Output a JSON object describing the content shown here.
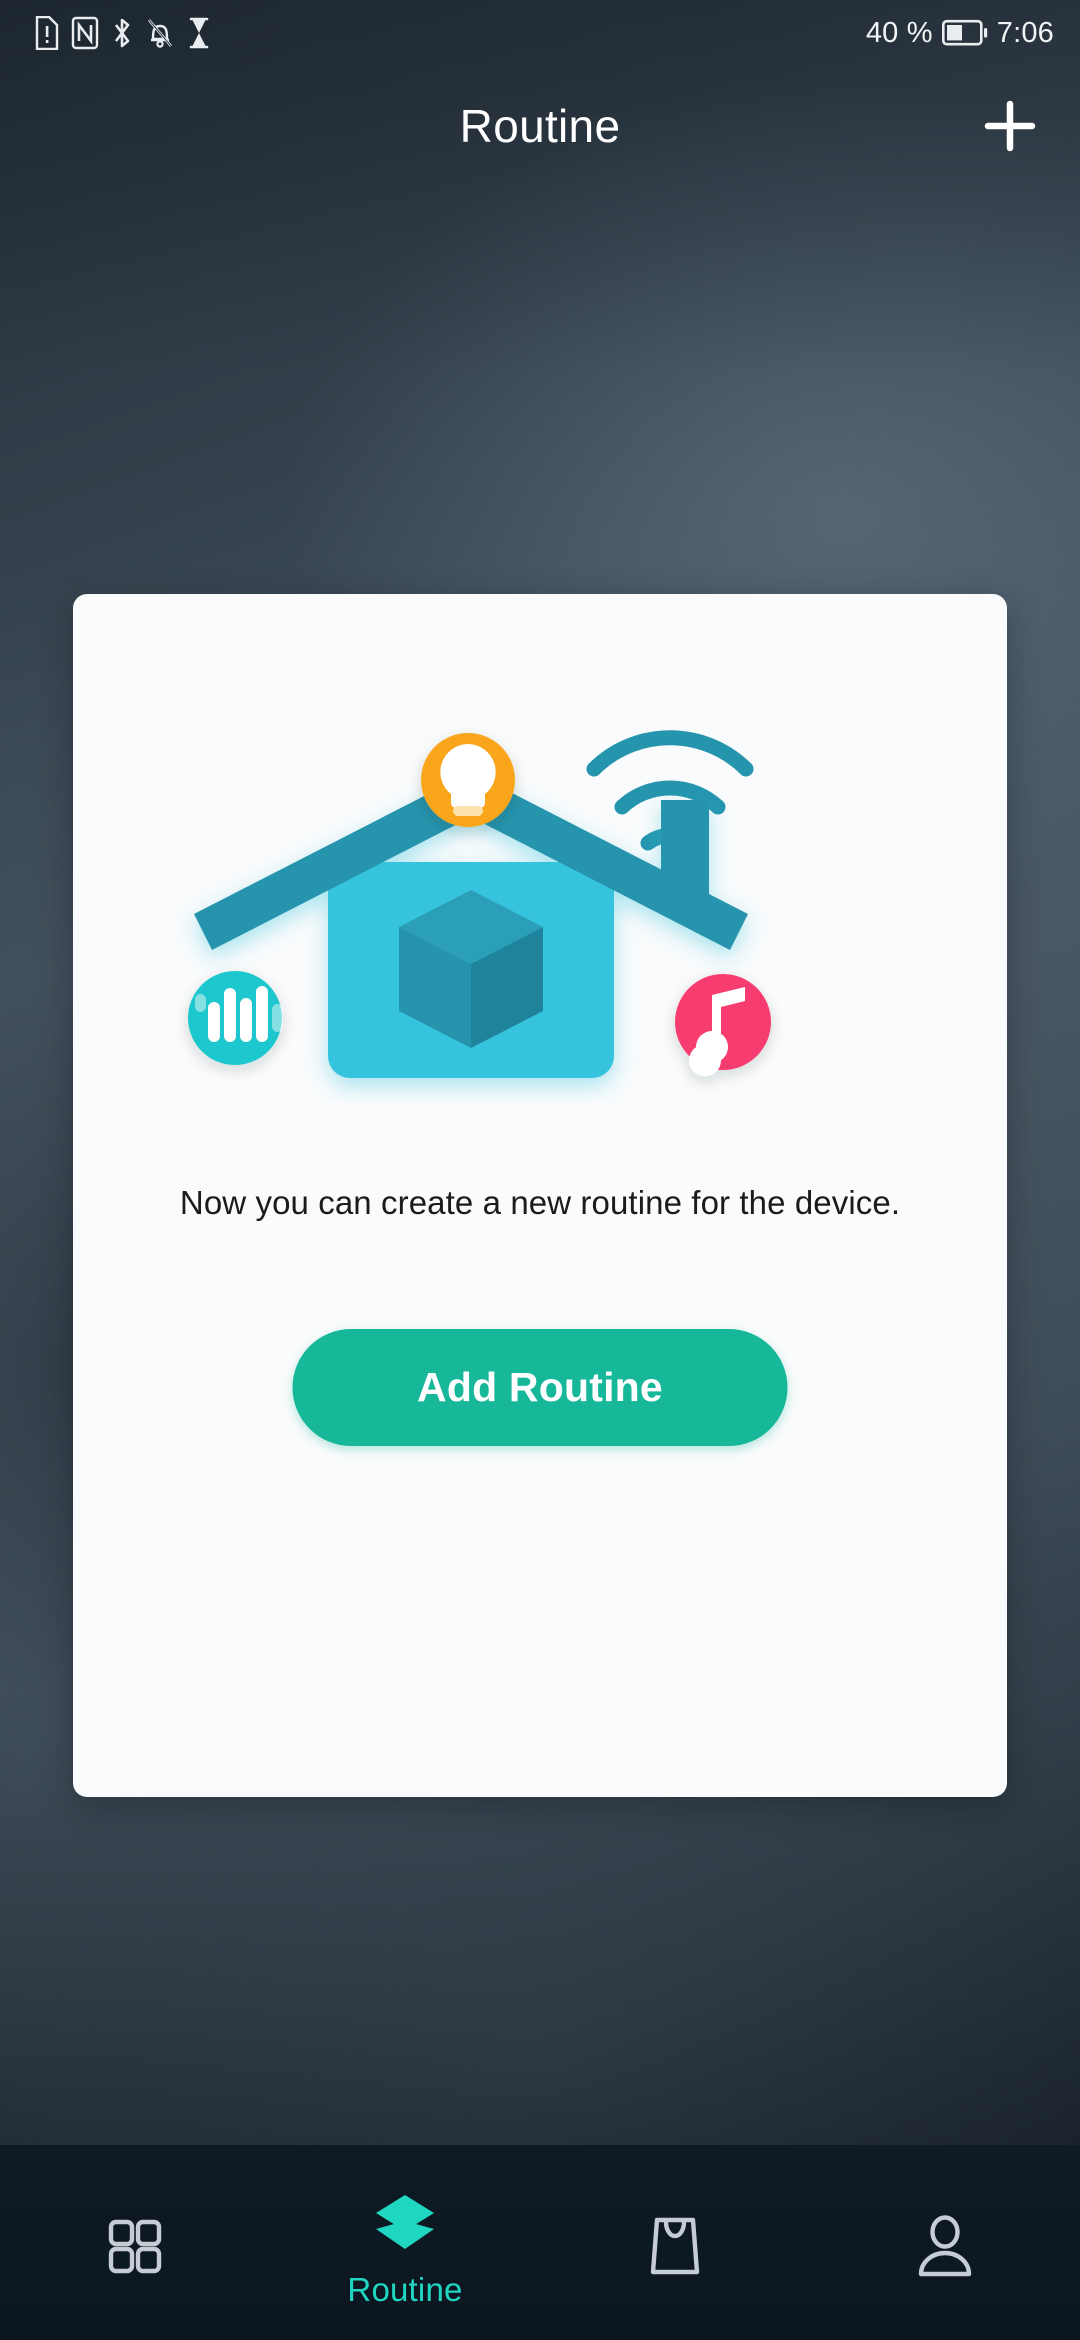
{
  "status_bar": {
    "icons": [
      "sim-alert-icon",
      "nfc-icon",
      "bluetooth-icon",
      "notifications-silenced-icon",
      "hourglass-icon"
    ],
    "battery_percent": "40 %",
    "battery_icon": "battery-half-icon",
    "time": "7:06"
  },
  "app_bar": {
    "title": "Routine",
    "add_icon": "plus-icon"
  },
  "card": {
    "illustration_name": "smart-home-illustration",
    "illustration_parts": [
      "lightbulb-badge-icon",
      "wifi-signal-icon",
      "house-icon",
      "cube-icon",
      "equalizer-badge-icon",
      "music-note-badge-icon"
    ],
    "empty_message": "Now you can create a new routine for the device.",
    "primary_button": "Add Routine"
  },
  "bottom_nav": {
    "items": [
      {
        "label": "",
        "icon": "grid-icon",
        "active": false
      },
      {
        "label": "Routine",
        "icon": "layers-icon",
        "active": true
      },
      {
        "label": "",
        "icon": "shopping-bag-icon",
        "active": false
      },
      {
        "label": "",
        "icon": "person-icon",
        "active": false
      }
    ]
  },
  "colors": {
    "accent_teal": "#17b79a",
    "nav_active": "#1fd6c1",
    "house_body": "#35c3dd",
    "house_roof": "#2594ad",
    "bulb_orange": "#faa61a",
    "music_pink": "#f73e6f",
    "equalizer_cyan": "#1fc8cd",
    "card_bg": "#fafbfc",
    "nav_inactive": "#c6ccd4"
  }
}
